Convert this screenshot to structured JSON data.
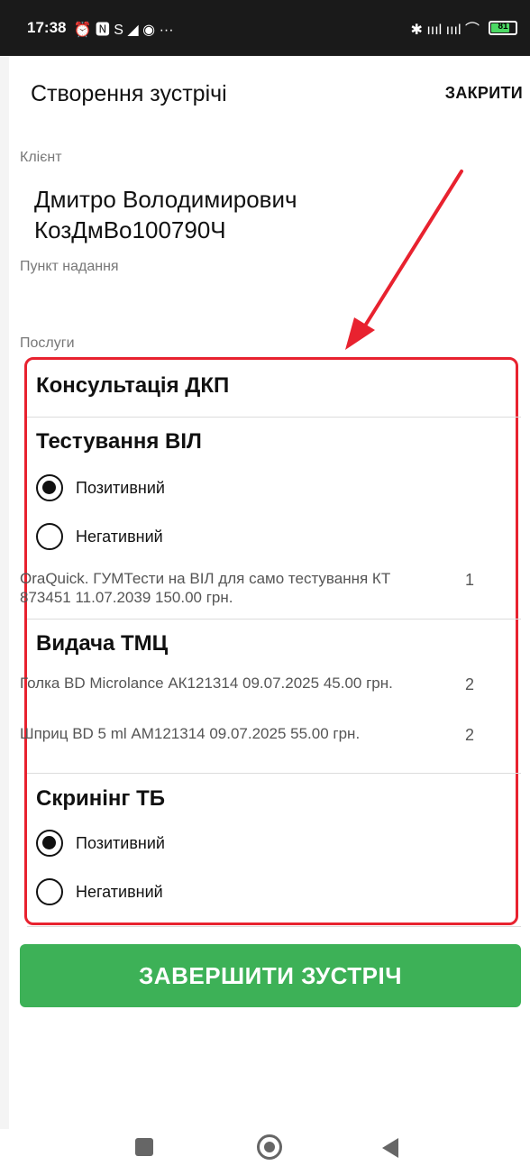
{
  "status_bar": {
    "time": "17:38",
    "left_icons": "⏰ 🅽 S ◢ ◉ ···",
    "right_icons": "✱ ıııl ıııl ⌒",
    "battery_level": "81"
  },
  "header": {
    "title": "Створення зустрічі",
    "close_label": "ЗАКРИТИ"
  },
  "client": {
    "label": "Клієнт",
    "name": "Дмитро Володимирович КозДмВо100790Ч"
  },
  "point": {
    "label": "Пункт надання"
  },
  "services": {
    "label": "Послуги",
    "consultation": {
      "title": "Консультація ДКП"
    },
    "hiv_testing": {
      "title": "Тестування ВІЛ",
      "positive_label": "Позитивний",
      "negative_label": "Негативний",
      "selected": "Позитивний",
      "items": [
        {
          "name": "OraQuick. ГУМТести на ВІЛ для само тестування КТ 873451 11.07.2039 150.00 грн.",
          "qty": "1"
        }
      ]
    },
    "issuance": {
      "title": "Видача ТМЦ",
      "items": [
        {
          "name": "Голка BD Microlance АК121314 09.07.2025 45.00 грн.",
          "qty": "2"
        },
        {
          "name": "Шприц BD 5 ml АМ121314 09.07.2025 55.00 грн.",
          "qty": "2"
        }
      ]
    },
    "tb_screening": {
      "title": "Скринінг ТБ",
      "positive_label": "Позитивний",
      "negative_label": "Негативний",
      "selected": "Позитивний"
    }
  },
  "finish_button_label": "ЗАВЕРШИТИ ЗУСТРІЧ",
  "colors": {
    "accent_green": "#3db157",
    "highlight_red": "#e8222f"
  }
}
